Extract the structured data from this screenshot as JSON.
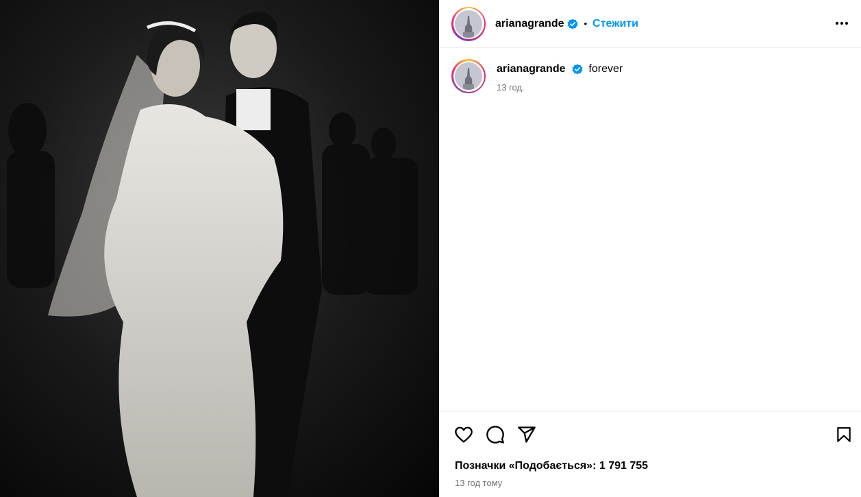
{
  "post": {
    "username": "arianagrande",
    "follow_label": "Стежити",
    "separator": "•",
    "caption": "forever",
    "caption_time": "13 год.",
    "likes_text": "Позначки «Подобається»: 1 791 755",
    "post_time": "13 год тому"
  },
  "icons": {
    "verified": "verified-badge-icon",
    "more": "more-options-icon",
    "like": "heart-icon",
    "comment": "comment-icon",
    "share": "send-icon",
    "save": "bookmark-icon"
  },
  "colors": {
    "accent": "#0095f6",
    "secondary_text": "#737373",
    "divider": "#efefef"
  }
}
